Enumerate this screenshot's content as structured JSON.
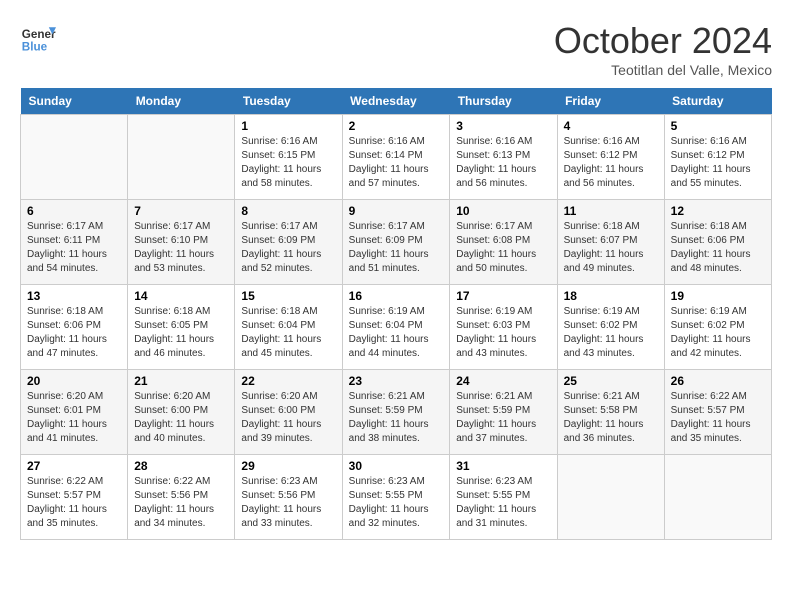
{
  "header": {
    "logo_line1": "General",
    "logo_line2": "Blue",
    "month": "October 2024",
    "location": "Teotitlan del Valle, Mexico"
  },
  "weekdays": [
    "Sunday",
    "Monday",
    "Tuesday",
    "Wednesday",
    "Thursday",
    "Friday",
    "Saturday"
  ],
  "weeks": [
    [
      {
        "day": "",
        "info": ""
      },
      {
        "day": "",
        "info": ""
      },
      {
        "day": "1",
        "info": "Sunrise: 6:16 AM\nSunset: 6:15 PM\nDaylight: 11 hours and 58 minutes."
      },
      {
        "day": "2",
        "info": "Sunrise: 6:16 AM\nSunset: 6:14 PM\nDaylight: 11 hours and 57 minutes."
      },
      {
        "day": "3",
        "info": "Sunrise: 6:16 AM\nSunset: 6:13 PM\nDaylight: 11 hours and 56 minutes."
      },
      {
        "day": "4",
        "info": "Sunrise: 6:16 AM\nSunset: 6:12 PM\nDaylight: 11 hours and 56 minutes."
      },
      {
        "day": "5",
        "info": "Sunrise: 6:16 AM\nSunset: 6:12 PM\nDaylight: 11 hours and 55 minutes."
      }
    ],
    [
      {
        "day": "6",
        "info": "Sunrise: 6:17 AM\nSunset: 6:11 PM\nDaylight: 11 hours and 54 minutes."
      },
      {
        "day": "7",
        "info": "Sunrise: 6:17 AM\nSunset: 6:10 PM\nDaylight: 11 hours and 53 minutes."
      },
      {
        "day": "8",
        "info": "Sunrise: 6:17 AM\nSunset: 6:09 PM\nDaylight: 11 hours and 52 minutes."
      },
      {
        "day": "9",
        "info": "Sunrise: 6:17 AM\nSunset: 6:09 PM\nDaylight: 11 hours and 51 minutes."
      },
      {
        "day": "10",
        "info": "Sunrise: 6:17 AM\nSunset: 6:08 PM\nDaylight: 11 hours and 50 minutes."
      },
      {
        "day": "11",
        "info": "Sunrise: 6:18 AM\nSunset: 6:07 PM\nDaylight: 11 hours and 49 minutes."
      },
      {
        "day": "12",
        "info": "Sunrise: 6:18 AM\nSunset: 6:06 PM\nDaylight: 11 hours and 48 minutes."
      }
    ],
    [
      {
        "day": "13",
        "info": "Sunrise: 6:18 AM\nSunset: 6:06 PM\nDaylight: 11 hours and 47 minutes."
      },
      {
        "day": "14",
        "info": "Sunrise: 6:18 AM\nSunset: 6:05 PM\nDaylight: 11 hours and 46 minutes."
      },
      {
        "day": "15",
        "info": "Sunrise: 6:18 AM\nSunset: 6:04 PM\nDaylight: 11 hours and 45 minutes."
      },
      {
        "day": "16",
        "info": "Sunrise: 6:19 AM\nSunset: 6:04 PM\nDaylight: 11 hours and 44 minutes."
      },
      {
        "day": "17",
        "info": "Sunrise: 6:19 AM\nSunset: 6:03 PM\nDaylight: 11 hours and 43 minutes."
      },
      {
        "day": "18",
        "info": "Sunrise: 6:19 AM\nSunset: 6:02 PM\nDaylight: 11 hours and 43 minutes."
      },
      {
        "day": "19",
        "info": "Sunrise: 6:19 AM\nSunset: 6:02 PM\nDaylight: 11 hours and 42 minutes."
      }
    ],
    [
      {
        "day": "20",
        "info": "Sunrise: 6:20 AM\nSunset: 6:01 PM\nDaylight: 11 hours and 41 minutes."
      },
      {
        "day": "21",
        "info": "Sunrise: 6:20 AM\nSunset: 6:00 PM\nDaylight: 11 hours and 40 minutes."
      },
      {
        "day": "22",
        "info": "Sunrise: 6:20 AM\nSunset: 6:00 PM\nDaylight: 11 hours and 39 minutes."
      },
      {
        "day": "23",
        "info": "Sunrise: 6:21 AM\nSunset: 5:59 PM\nDaylight: 11 hours and 38 minutes."
      },
      {
        "day": "24",
        "info": "Sunrise: 6:21 AM\nSunset: 5:59 PM\nDaylight: 11 hours and 37 minutes."
      },
      {
        "day": "25",
        "info": "Sunrise: 6:21 AM\nSunset: 5:58 PM\nDaylight: 11 hours and 36 minutes."
      },
      {
        "day": "26",
        "info": "Sunrise: 6:22 AM\nSunset: 5:57 PM\nDaylight: 11 hours and 35 minutes."
      }
    ],
    [
      {
        "day": "27",
        "info": "Sunrise: 6:22 AM\nSunset: 5:57 PM\nDaylight: 11 hours and 35 minutes."
      },
      {
        "day": "28",
        "info": "Sunrise: 6:22 AM\nSunset: 5:56 PM\nDaylight: 11 hours and 34 minutes."
      },
      {
        "day": "29",
        "info": "Sunrise: 6:23 AM\nSunset: 5:56 PM\nDaylight: 11 hours and 33 minutes."
      },
      {
        "day": "30",
        "info": "Sunrise: 6:23 AM\nSunset: 5:55 PM\nDaylight: 11 hours and 32 minutes."
      },
      {
        "day": "31",
        "info": "Sunrise: 6:23 AM\nSunset: 5:55 PM\nDaylight: 11 hours and 31 minutes."
      },
      {
        "day": "",
        "info": ""
      },
      {
        "day": "",
        "info": ""
      }
    ]
  ]
}
